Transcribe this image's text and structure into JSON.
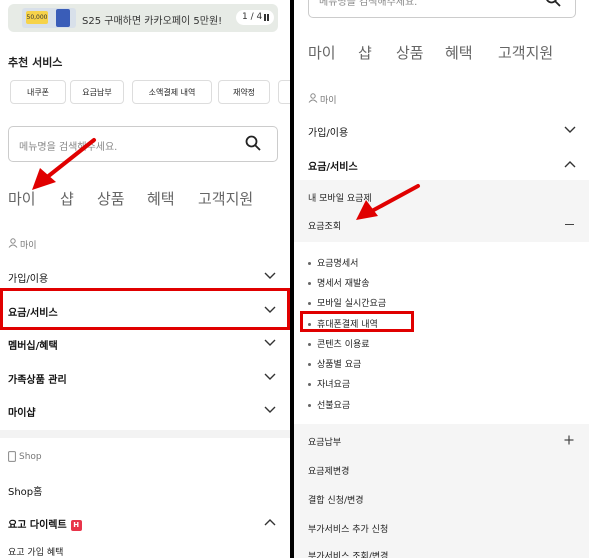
{
  "left": {
    "banner": {
      "text": "S25 구매하면 카카오페이 5만원!",
      "badge": "50,000",
      "pager": "1 / 4"
    },
    "recommended": {
      "title": "추천 서비스",
      "chips": [
        "내쿠폰",
        "요금납부",
        "소액결제 내역",
        "재약정"
      ]
    },
    "search": {
      "placeholder": "메뉴명을 검색해주세요."
    },
    "tabs": [
      "마이",
      "샵",
      "상품",
      "혜택",
      "고객지원"
    ],
    "my_caption": "마이",
    "menu": [
      "가입/이용",
      "요금/서비스",
      "멤버십/혜택",
      "가족상품 관리",
      "마이샵"
    ],
    "shop_caption": "Shop",
    "shop_home": "Shop홈",
    "direct": {
      "label": "요고 다이렉트",
      "badge": "H"
    },
    "direct_sub": "요고 가입 혜택"
  },
  "right": {
    "search": {
      "placeholder": "메뉴명을 검색해주세요."
    },
    "tabs": [
      "마이",
      "샵",
      "상품",
      "혜택",
      "고객지원"
    ],
    "my_caption": "마이",
    "join": "가입/이용",
    "service": "요금/서비스",
    "mobile_fee": "내 모바일 요금제",
    "fee_inquiry": "요금조회",
    "fee_items": [
      "요금명세서",
      "명세서 재발송",
      "모바일 실시간요금",
      "휴대폰결제 내역",
      "콘텐츠 이용료",
      "상품별 요금",
      "자녀요금",
      "선불요금"
    ],
    "payment": "요금납부",
    "plan_change": "요금제변경",
    "combo": "결합 신청/변경",
    "addon": "부가서비스 추가 신청",
    "addon2": "부가서비스 조회/변경"
  }
}
